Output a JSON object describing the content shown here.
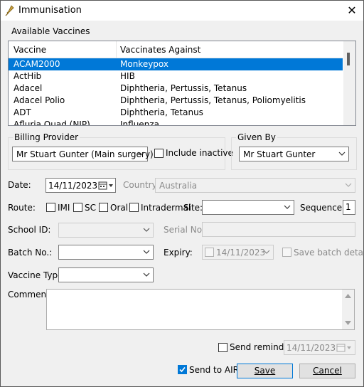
{
  "window": {
    "title": "Immunisation",
    "close_glyph": "✕",
    "app_icon": "syringe-icon"
  },
  "vaccines": {
    "label": "Available Vaccines",
    "columns": [
      "Vaccine",
      "Vaccinates Against"
    ],
    "rows": [
      {
        "vaccine": "ACAM2000",
        "against": "Monkeypox",
        "selected": true
      },
      {
        "vaccine": "ActHib",
        "against": "HIB"
      },
      {
        "vaccine": "Adacel",
        "against": "Diphtheria, Pertussis, Tetanus"
      },
      {
        "vaccine": "Adacel Polio",
        "against": "Diphtheria, Pertussis, Tetanus, Poliomyelitis"
      },
      {
        "vaccine": "ADT",
        "against": "Diphtheria, Tetanus"
      },
      {
        "vaccine": "Afluria Quad (NIP)",
        "against": "Influenza"
      }
    ]
  },
  "billing": {
    "label": "Billing Provider",
    "value": "Mr Stuart Gunter (Main surgery)",
    "include_inactive": "Include inactive"
  },
  "given_by": {
    "label": "Given By",
    "value": "Mr Stuart Gunter"
  },
  "date": {
    "label": "Date:",
    "value": "14/11/2023"
  },
  "country": {
    "label": "Country:",
    "value": "Australia"
  },
  "route": {
    "label": "Route:",
    "options": [
      "IMI",
      "SC",
      "Oral",
      "Intradermal"
    ]
  },
  "site": {
    "label": "Site:",
    "value": ""
  },
  "sequence": {
    "label": "Sequence:",
    "value": "1"
  },
  "school_id": {
    "label": "School ID:",
    "value": ""
  },
  "serial": {
    "label": "Serial No.:",
    "value": ""
  },
  "batch": {
    "label": "Batch No.:",
    "value": ""
  },
  "expiry": {
    "label": "Expiry:",
    "value": "14/11/2023"
  },
  "save_batch": {
    "label": "Save batch details"
  },
  "vaccine_type": {
    "label": "Vaccine Type:",
    "value": ""
  },
  "comment": {
    "label": "Comment:",
    "value": ""
  },
  "reminder": {
    "label": "Send reminder",
    "date": "14/11/2023"
  },
  "air": {
    "label": "Send to AIR",
    "checked": true
  },
  "buttons": {
    "save": "Save",
    "cancel": "Cancel"
  },
  "colors": {
    "selection": "#0078d7",
    "window_bg": "#f0f0f0"
  }
}
